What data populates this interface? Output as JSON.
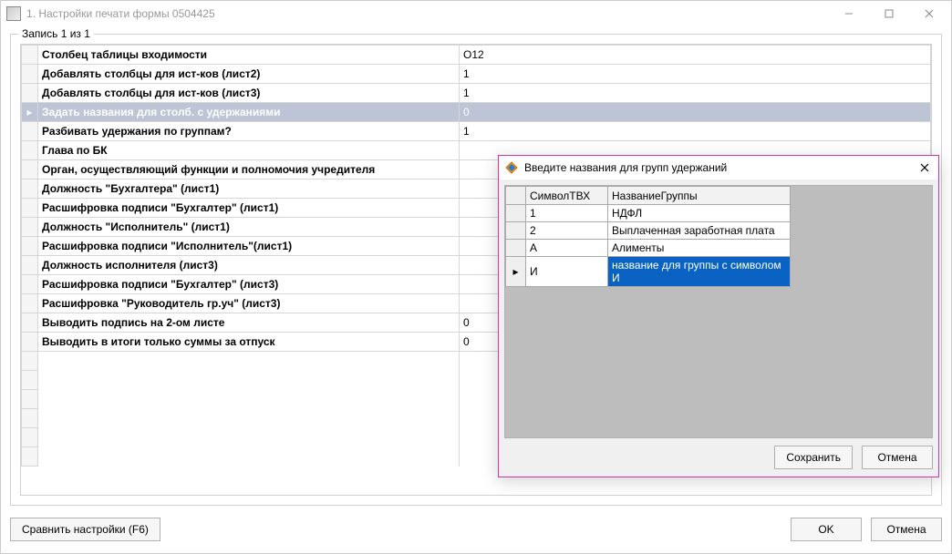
{
  "window": {
    "title": "1. Настройки печати формы 0504425"
  },
  "group": {
    "legend": "Запись 1 из 1"
  },
  "grid": {
    "rows": [
      {
        "key": "Столбец таблицы входимости",
        "val": "O12",
        "selected": false
      },
      {
        "key": "Добавлять столбцы для ист-ков (лист2)",
        "val": "1",
        "selected": false
      },
      {
        "key": "Добавлять столбцы для ист-ков (лист3)",
        "val": "1",
        "selected": false
      },
      {
        "key": "Задать названия для столб. с удержаниями",
        "val": "0",
        "selected": true
      },
      {
        "key": "Разбивать удержания по группам?",
        "val": "1",
        "selected": false
      },
      {
        "key": "Глава по БК",
        "val": "",
        "selected": false
      },
      {
        "key": "Орган, осуществляющий функции и полномочия учредителя",
        "val": "",
        "selected": false
      },
      {
        "key": "Должность \"Бухгалтера\" (лист1)",
        "val": "",
        "selected": false
      },
      {
        "key": "Расшифровка подписи \"Бухгалтер\" (лист1)",
        "val": "",
        "selected": false
      },
      {
        "key": "Должность \"Исполнитель\" (лист1)",
        "val": "",
        "selected": false
      },
      {
        "key": "Расшифровка подписи \"Исполнитель\"(лист1)",
        "val": "",
        "selected": false
      },
      {
        "key": "Должность исполнителя (лист3)",
        "val": "",
        "selected": false
      },
      {
        "key": "Расшифровка подписи \"Бухгалтер\" (лист3)",
        "val": "",
        "selected": false
      },
      {
        "key": "Расшифровка \"Руководитель гр.уч\" (лист3)",
        "val": "",
        "selected": false
      },
      {
        "key": "Выводить подпись на 2-ом листе",
        "val": "0",
        "selected": false
      },
      {
        "key": "Выводить в итоги только суммы за отпуск",
        "val": "0",
        "selected": false
      }
    ]
  },
  "buttons": {
    "compare": "Сравнить настройки (F6)",
    "ok": "OK",
    "cancel": "Отмена"
  },
  "dialog": {
    "title": "Введите названия для групп удержаний",
    "cols": {
      "c1": "СимволТВХ",
      "c2": "НазваниеГруппы"
    },
    "rows": [
      {
        "sym": "1",
        "name": "НДФЛ",
        "editing": false
      },
      {
        "sym": "2",
        "name": "Выплаченная заработная плата",
        "editing": false
      },
      {
        "sym": "А",
        "name": "Алименты",
        "editing": false
      },
      {
        "sym": "И",
        "name": "название для группы с символом И",
        "editing": true
      }
    ],
    "buttons": {
      "save": "Сохранить",
      "cancel": "Отмена"
    }
  }
}
